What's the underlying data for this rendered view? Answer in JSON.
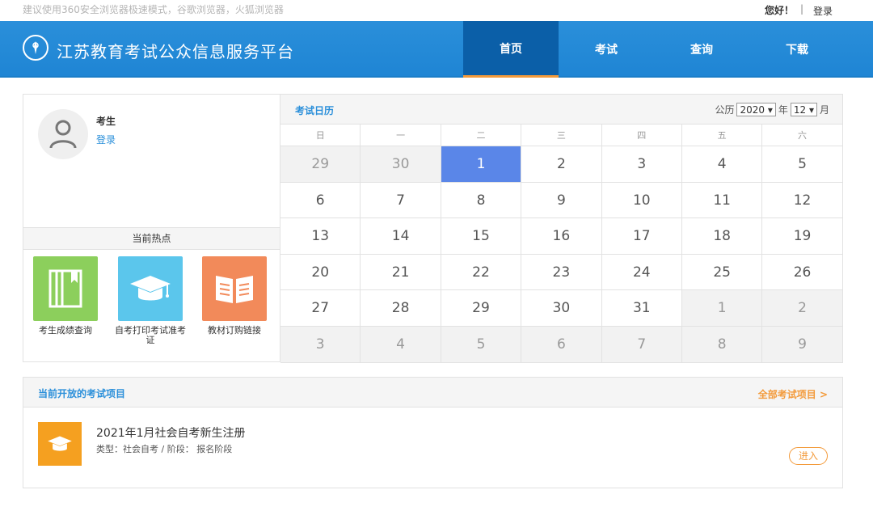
{
  "notice": {
    "tip": "建议使用360安全浏览器极速模式，谷歌浏览器，火狐浏览器",
    "hello": "您好！",
    "separator": "|",
    "login": "登录"
  },
  "header": {
    "title": "江苏教育考试公众信息服务平台",
    "nav": [
      {
        "label": "首页",
        "active": true
      },
      {
        "label": "考试",
        "active": false
      },
      {
        "label": "查询",
        "active": false
      },
      {
        "label": "下载",
        "active": false
      }
    ]
  },
  "user": {
    "label": "考生",
    "login": "登录"
  },
  "hot": {
    "title": "当前热点",
    "tiles": [
      {
        "label": "考生成绩查询",
        "color": "#8ccf5c",
        "icon": "book-icon"
      },
      {
        "label": "自考打印考试准考证",
        "color": "#5bc6ec",
        "icon": "graduation-cap-icon"
      },
      {
        "label": "教材订购链接",
        "color": "#f28a5a",
        "icon": "open-book-icon"
      }
    ]
  },
  "calendar": {
    "title": "考试日历",
    "calendar_label": "公历",
    "year": "2020",
    "year_unit": "年",
    "month": "12",
    "month_unit": "月",
    "weekdays": [
      "日",
      "一",
      "二",
      "三",
      "四",
      "五",
      "六"
    ],
    "weeks": [
      [
        "29",
        "30",
        "1",
        "2",
        "3",
        "4",
        "5"
      ],
      [
        "6",
        "7",
        "8",
        "9",
        "10",
        "11",
        "12"
      ],
      [
        "13",
        "14",
        "15",
        "16",
        "17",
        "18",
        "19"
      ],
      [
        "20",
        "21",
        "22",
        "23",
        "24",
        "25",
        "26"
      ],
      [
        "27",
        "28",
        "29",
        "30",
        "31",
        "1",
        "2"
      ],
      [
        "3",
        "4",
        "5",
        "6",
        "7",
        "8",
        "9"
      ]
    ],
    "today": "1",
    "today_color": "#5a86e8"
  },
  "exams": {
    "title": "当前开放的考试项目",
    "all_link": "全部考试项目 >",
    "items": [
      {
        "name": "2021年1月社会自考新生注册",
        "meta": "类型：社会自考 / 阶段： 报名阶段",
        "action": "进入",
        "icon": "graduation-cap-icon"
      }
    ]
  },
  "colors": {
    "brand": "#2a8fda",
    "accent": "#f39a3a",
    "nav_active": "#0b5fa8"
  }
}
